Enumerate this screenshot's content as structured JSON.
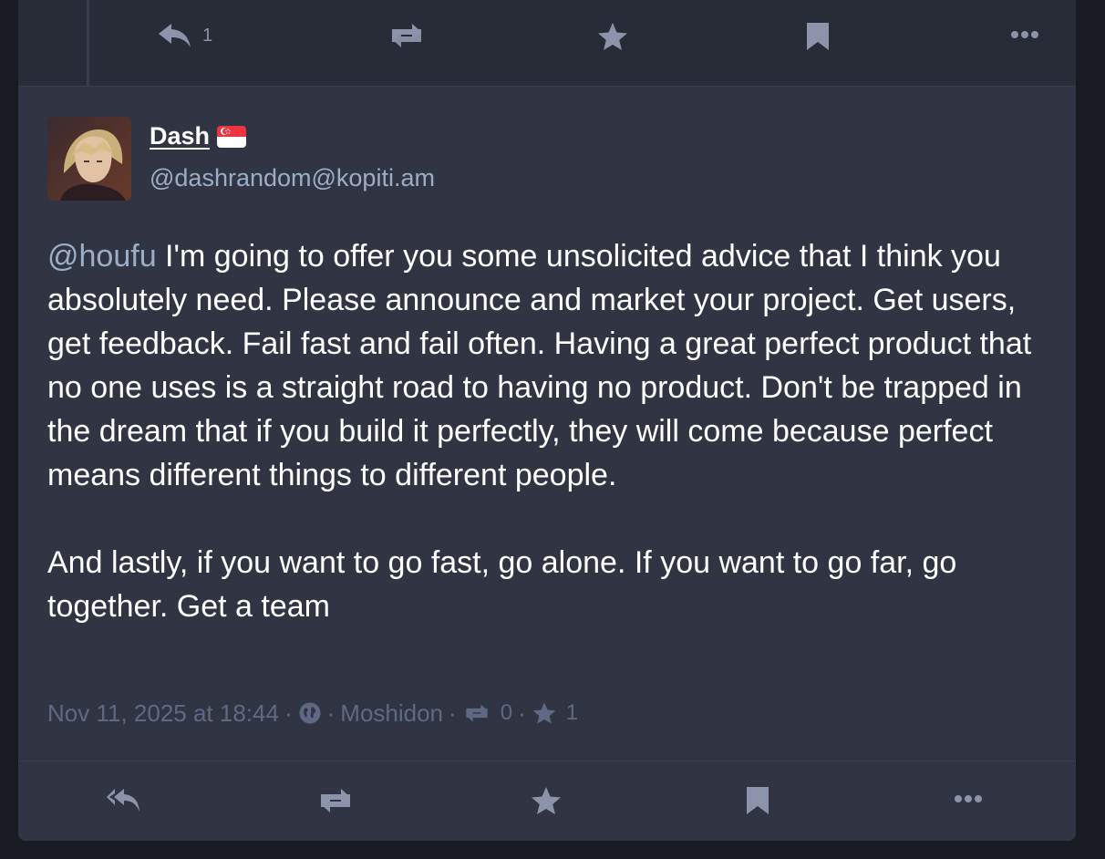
{
  "parent_actions": {
    "reply_count": "1"
  },
  "author": {
    "display_name": "Dash",
    "flag_icon": "singapore-flag-icon",
    "handle": "@dashrandom@kopiti.am"
  },
  "post": {
    "mention": "@houfu",
    "paragraph1_rest": " I'm going to offer you some unsolicited advice that I think you absolutely need. Please announce and market your project. Get users, get feedback. Fail fast and fail often. Having a great perfect product that no one uses is a straight road to having no product. Don't be trapped in the dream that if you build it perfectly, they will come because perfect means different things to different people.",
    "paragraph2": "And lastly, if you want to go fast, go alone. If you want to go far, go together. Get a team"
  },
  "meta": {
    "timestamp": "Nov 11, 2025 at 18:44",
    "separator": "·",
    "visibility_icon": "globe-icon",
    "application": "Moshidon",
    "boost_count": "0",
    "favourite_count": "1"
  },
  "colors": {
    "background": "#191b22",
    "panel": "#313543",
    "top_bar": "#282c37",
    "text": "#ffffff",
    "secondary_text": "#9baec8",
    "meta_text": "#606984",
    "icon": "#8c93aa"
  }
}
